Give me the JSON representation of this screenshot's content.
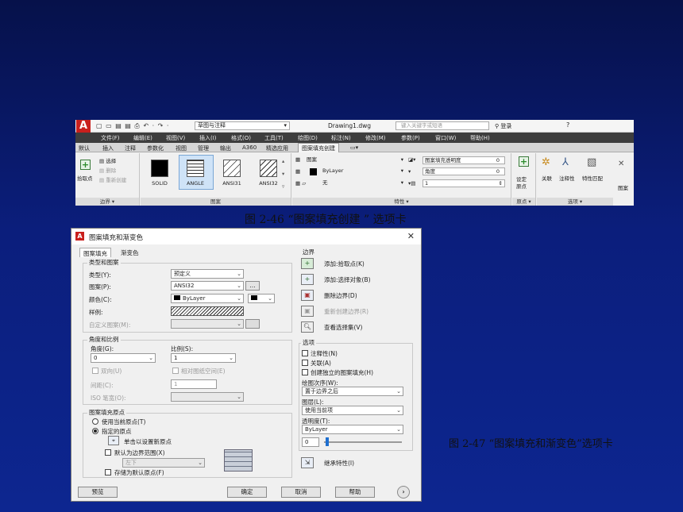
{
  "fig46": {
    "caption": "图 2-46 “图案填充创建 ” 选项卡",
    "titlebar": {
      "logo": "A",
      "workspace": "草图与注释",
      "document": "Drawing1.dwg",
      "search_placeholder": "键入关键字或短语",
      "login": "登录",
      "help": "?"
    },
    "menus": [
      "文件(F)",
      "编辑(E)",
      "视图(V)",
      "插入(I)",
      "格式(O)",
      "工具(T)",
      "绘图(D)",
      "标注(N)",
      "修改(M)",
      "参数(P)",
      "窗口(W)",
      "帮助(H)"
    ],
    "tabs": [
      "默认",
      "插入",
      "注释",
      "参数化",
      "视图",
      "管理",
      "输出",
      "A360",
      "精选应用",
      "图案填充创建"
    ],
    "boundary_panel": {
      "pick_label": "拾取点",
      "select": "选择",
      "remove": "删除",
      "recreate": "重新创建",
      "title": "边界 ▾"
    },
    "pattern_panel": {
      "title": "图案",
      "patterns": [
        "SOLID",
        "ANGLE",
        "ANSI31",
        "ANSI32"
      ]
    },
    "properties_panel": {
      "title": "特性 ▾",
      "type": "图案",
      "color": "ByLayer",
      "background": "无",
      "transparency_label": "图案填充透明度",
      "transparency": "0",
      "angle_label": "角度",
      "angle": "0",
      "scale": "1"
    },
    "origin_panel": {
      "line1": "设定",
      "line2": "原点",
      "title": "原点 ▾"
    },
    "options_panel": {
      "associative": "关联",
      "annotative": "注释性",
      "match": "特性匹配",
      "title": "选项 ▾",
      "close": "图案"
    }
  },
  "fig47": {
    "caption": "图 2-47 “图案填充和渐变色”选项卡",
    "title": "图案填充和渐变色",
    "close": "✕",
    "tabs": [
      "图案填充",
      "渐变色"
    ],
    "type_group": {
      "title": "类型和图案",
      "type_label": "类型(Y):",
      "type_value": "预定义",
      "pattern_label": "图案(P):",
      "pattern_value": "ANSI32",
      "color_label": "颜色(C):",
      "color_value": "ByLayer",
      "sample_label": "样例:",
      "custom_label": "自定义图案(M):"
    },
    "angle_group": {
      "title": "角度和比例",
      "angle_label": "角度(G):",
      "angle_value": "0",
      "scale_label": "比例(S):",
      "scale_value": "1",
      "double_label": "双向(U)",
      "relative_label": "相对图纸空间(E)",
      "spacing_label": "间距(C):",
      "spacing_value": "1",
      "iso_label": "ISO 笔宽(O):"
    },
    "origin_group": {
      "title": "图案填充原点",
      "current_label": "使用当前原点(T)",
      "specified_label": "指定的原点",
      "click_label": "单击以设置新原点",
      "default_label": "默认为边界范围(X)",
      "position_value": "左下",
      "store_label": "存储为默认原点(F)"
    },
    "boundary_group": {
      "title": "边界",
      "add_pick": "添加:拾取点(K)",
      "add_select": "添加:选择对象(B)",
      "remove": "删除边界(D)",
      "recreate": "重新创建边界(R)",
      "view": "查看选择集(V)"
    },
    "options_group": {
      "title": "选项",
      "annotative": "注释性(N)",
      "associative": "关联(A)",
      "separate": "创建独立的图案填充(H)",
      "draw_order_label": "绘图次序(W):",
      "draw_order_value": "置于边界之后",
      "layer_label": "图层(L):",
      "layer_value": "使用当前项",
      "transparency_label": "透明度(T):",
      "transparency_value": "ByLayer",
      "transparency_num": "0"
    },
    "inherit": "继承特性(I)",
    "buttons": {
      "preview": "预览",
      "ok": "确定",
      "cancel": "取消",
      "help": "帮助",
      "more": "›"
    }
  }
}
